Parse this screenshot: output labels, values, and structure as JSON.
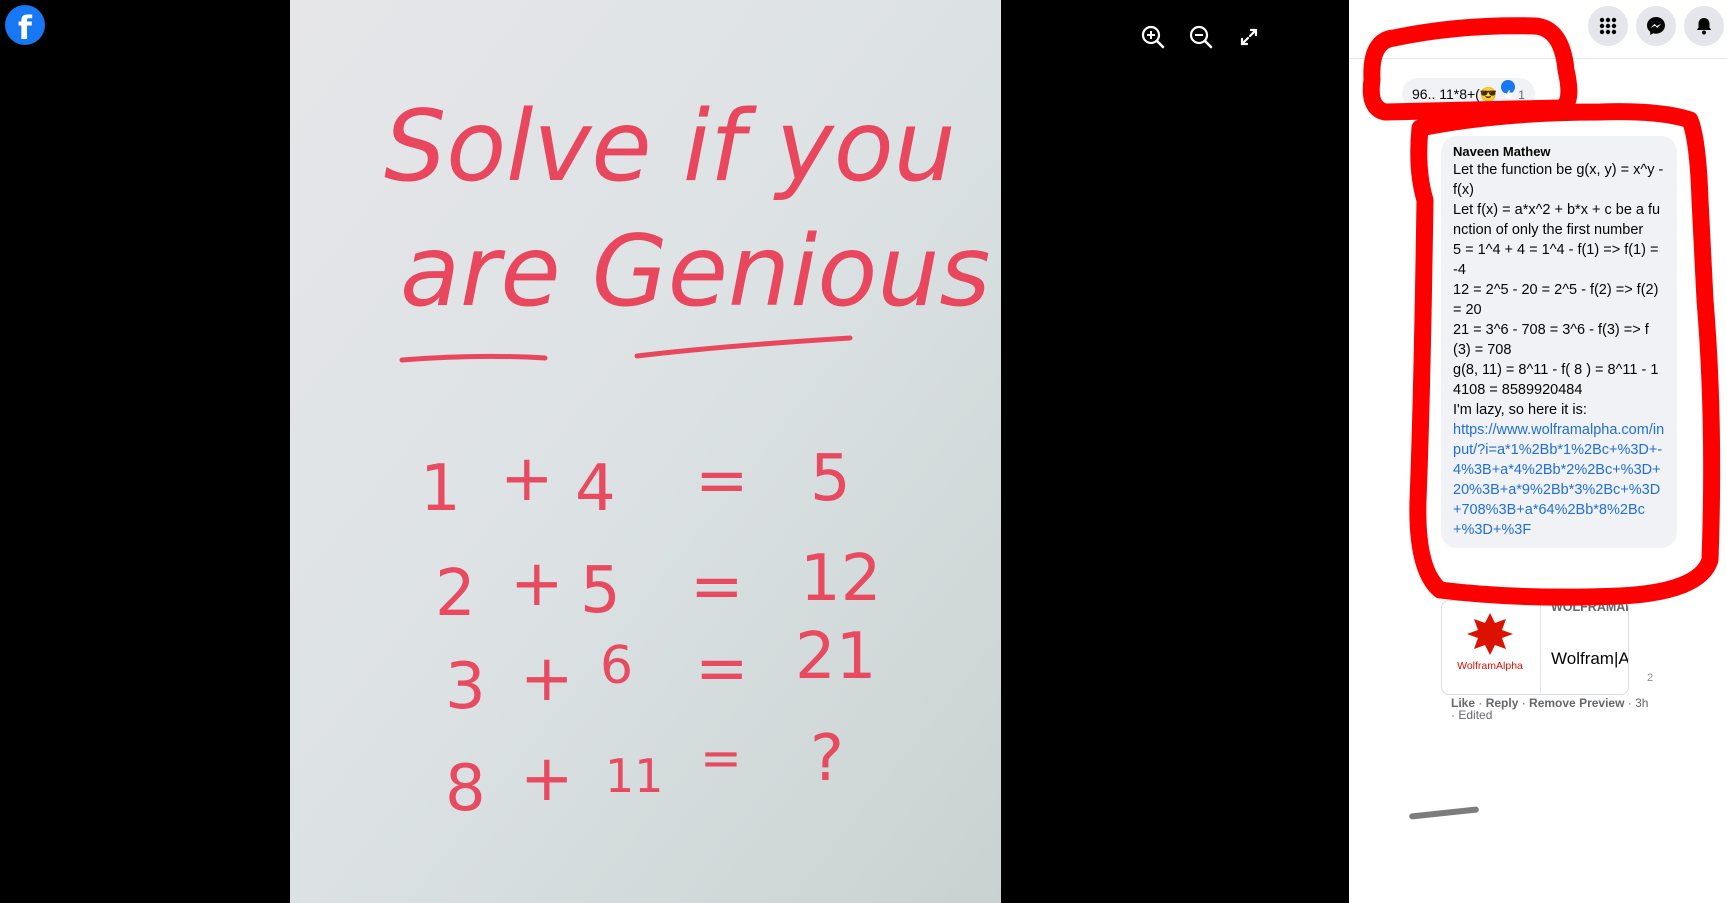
{
  "viewer": {
    "logo_letter": "f",
    "controls": [
      {
        "name": "zoom-in-icon"
      },
      {
        "name": "zoom-out-icon"
      },
      {
        "name": "fullscreen-icon"
      }
    ],
    "photo": {
      "title_line1": "Solve if you",
      "title_line2": "are Genious",
      "equations": [
        {
          "a": "1",
          "op": "+",
          "b": "4",
          "eq": "=",
          "r": "5"
        },
        {
          "a": "2",
          "op": "+",
          "b": "5",
          "eq": "=",
          "r": "12"
        },
        {
          "a": "3",
          "op": "+",
          "b": "6",
          "eq": "=",
          "r": "21"
        },
        {
          "a": "8",
          "op": "+",
          "b": "11",
          "eq": "=",
          "r": "?"
        }
      ]
    }
  },
  "header": {
    "icons": [
      "menu-grid-icon",
      "messenger-icon",
      "notifications-bell-icon"
    ]
  },
  "comments": [
    {
      "text": "96.. 11*8+(😎",
      "reaction_count": "1"
    },
    {
      "author": "Naveen Mathew",
      "lines": [
        "Let the function be g(x, y) = x^y - f(x)",
        "Let f(x) = a*x^2 + b*x + c be a function of only the first number",
        "5 = 1^4 + 4 = 1^4 - f(1) => f(1) = -4",
        "12 = 2^5 - 20 = 2^5 - f(2) => f(2) = 20",
        "21 = 3^6 - 708 = 3^6 - f(3) => f(3) = 708",
        "g(8, 11) = 8^11 - f( 8 ) = 8^11 - 14108 = 8589920484",
        "I'm lazy, so here it is:"
      ],
      "link": "https://www.wolframalpha.com/input/?i=a*1%2Bb*1%2Bc+%3D+-4%3B+a*4%2Bb*2%2Bc+%3D+20%3B+a*9%2Bb*3%2Bc+%3D+708%3B+a*64%2Bb*8%2Bc+%3D+%3F",
      "preview": {
        "domain": "WOLFRAMALPHA.COM",
        "logo_text": "WolframAlpha",
        "title": "Wolfram|Alp…"
      },
      "reaction_count": "2",
      "actions": {
        "like": "Like",
        "reply": "Reply",
        "remove_preview": "Remove Preview",
        "time": "3h",
        "edited": "Edited"
      }
    }
  ],
  "colors": {
    "facebook_blue": "#1877f2",
    "annotation_red": "#ff0000",
    "link_blue": "#216fdb"
  }
}
